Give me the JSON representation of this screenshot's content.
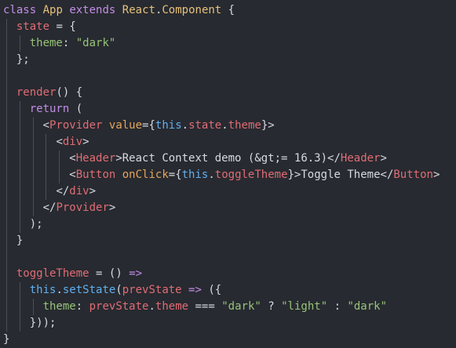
{
  "editor": {
    "lines": [
      {
        "indent": 0,
        "tokens": [
          [
            "kw",
            "class"
          ],
          [
            "txt",
            " "
          ],
          [
            "cls",
            "App"
          ],
          [
            "txt",
            " "
          ],
          [
            "kw",
            "extends"
          ],
          [
            "txt",
            " "
          ],
          [
            "cls",
            "React"
          ],
          [
            "sym",
            "."
          ],
          [
            "cls",
            "Component"
          ],
          [
            "txt",
            " "
          ],
          [
            "sym",
            "{"
          ]
        ]
      },
      {
        "indent": 1,
        "tokens": [
          [
            "var",
            "state"
          ],
          [
            "txt",
            " "
          ],
          [
            "sym",
            "="
          ],
          [
            "txt",
            " "
          ],
          [
            "sym",
            "{"
          ]
        ]
      },
      {
        "indent": 2,
        "tokens": [
          [
            "prop",
            "theme"
          ],
          [
            "sym",
            ":"
          ],
          [
            "txt",
            " "
          ],
          [
            "str",
            "\"dark\""
          ]
        ]
      },
      {
        "indent": 1,
        "tokens": [
          [
            "sym",
            "};"
          ]
        ]
      },
      {
        "indent": 1,
        "tokens": []
      },
      {
        "indent": 1,
        "tokens": [
          [
            "var",
            "render"
          ],
          [
            "sym",
            "()"
          ],
          [
            "txt",
            " "
          ],
          [
            "sym",
            "{"
          ]
        ]
      },
      {
        "indent": 2,
        "tokens": [
          [
            "kw",
            "return"
          ],
          [
            "txt",
            " "
          ],
          [
            "sym",
            "("
          ]
        ]
      },
      {
        "indent": 3,
        "tokens": [
          [
            "sym",
            "<"
          ],
          [
            "tag",
            "Provider"
          ],
          [
            "txt",
            " "
          ],
          [
            "attr",
            "value"
          ],
          [
            "sym",
            "={"
          ],
          [
            "this",
            "this"
          ],
          [
            "sym",
            "."
          ],
          [
            "field",
            "state"
          ],
          [
            "sym",
            "."
          ],
          [
            "field",
            "theme"
          ],
          [
            "sym",
            "}>"
          ]
        ]
      },
      {
        "indent": 4,
        "tokens": [
          [
            "sym",
            "<"
          ],
          [
            "tag",
            "div"
          ],
          [
            "sym",
            ">"
          ]
        ]
      },
      {
        "indent": 5,
        "tokens": [
          [
            "sym",
            "<"
          ],
          [
            "tag",
            "Header"
          ],
          [
            "sym",
            ">"
          ],
          [
            "txt",
            "React Context demo (&gt;= 16.3)"
          ],
          [
            "sym",
            "</"
          ],
          [
            "tag",
            "Header"
          ],
          [
            "sym",
            ">"
          ]
        ]
      },
      {
        "indent": 5,
        "tokens": [
          [
            "sym",
            "<"
          ],
          [
            "tag",
            "Button"
          ],
          [
            "txt",
            " "
          ],
          [
            "attr",
            "onClick"
          ],
          [
            "sym",
            "={"
          ],
          [
            "this",
            "this"
          ],
          [
            "sym",
            "."
          ],
          [
            "field",
            "toggleTheme"
          ],
          [
            "sym",
            "}>"
          ],
          [
            "txt",
            "Toggle Theme"
          ],
          [
            "sym",
            "</"
          ],
          [
            "tag",
            "Button"
          ],
          [
            "sym",
            ">"
          ]
        ]
      },
      {
        "indent": 4,
        "tokens": [
          [
            "sym",
            "</"
          ],
          [
            "tag",
            "div"
          ],
          [
            "sym",
            ">"
          ]
        ]
      },
      {
        "indent": 3,
        "tokens": [
          [
            "sym",
            "</"
          ],
          [
            "tag",
            "Provider"
          ],
          [
            "sym",
            ">"
          ]
        ]
      },
      {
        "indent": 2,
        "tokens": [
          [
            "sym",
            ");"
          ]
        ]
      },
      {
        "indent": 1,
        "tokens": [
          [
            "sym",
            "}"
          ]
        ]
      },
      {
        "indent": 1,
        "tokens": []
      },
      {
        "indent": 1,
        "tokens": [
          [
            "var",
            "toggleTheme"
          ],
          [
            "txt",
            " "
          ],
          [
            "sym",
            "="
          ],
          [
            "txt",
            " "
          ],
          [
            "sym",
            "()"
          ],
          [
            "txt",
            " "
          ],
          [
            "kw",
            "=>"
          ]
        ]
      },
      {
        "indent": 2,
        "tokens": [
          [
            "this",
            "this"
          ],
          [
            "sym",
            "."
          ],
          [
            "call",
            "setState"
          ],
          [
            "sym",
            "("
          ],
          [
            "var",
            "prevState"
          ],
          [
            "txt",
            " "
          ],
          [
            "kw",
            "=>"
          ],
          [
            "txt",
            " "
          ],
          [
            "sym",
            "({"
          ]
        ]
      },
      {
        "indent": 3,
        "tokens": [
          [
            "prop",
            "theme"
          ],
          [
            "sym",
            ":"
          ],
          [
            "txt",
            " "
          ],
          [
            "var",
            "prevState"
          ],
          [
            "sym",
            "."
          ],
          [
            "field",
            "theme"
          ],
          [
            "txt",
            " "
          ],
          [
            "sym",
            "==="
          ],
          [
            "txt",
            " "
          ],
          [
            "str",
            "\"dark\""
          ],
          [
            "txt",
            " "
          ],
          [
            "sym",
            "?"
          ],
          [
            "txt",
            " "
          ],
          [
            "str",
            "\"light\""
          ],
          [
            "txt",
            " "
          ],
          [
            "sym",
            ":"
          ],
          [
            "txt",
            " "
          ],
          [
            "str",
            "\"dark\""
          ]
        ]
      },
      {
        "indent": 2,
        "tokens": [
          [
            "sym",
            "}));"
          ]
        ]
      },
      {
        "indent": 0,
        "tokens": [
          [
            "sym",
            "}"
          ]
        ]
      }
    ]
  }
}
